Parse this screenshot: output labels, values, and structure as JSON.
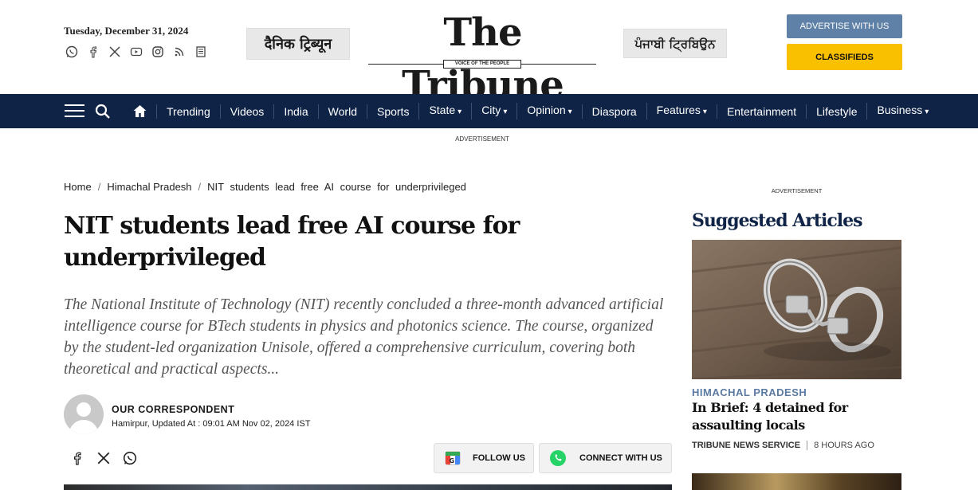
{
  "header": {
    "date": "Tuesday, December 31, 2024",
    "socials": [
      "whatsapp-icon",
      "facebook-icon",
      "x-icon",
      "youtube-icon",
      "instagram-icon",
      "rss-icon",
      "epaper-icon"
    ],
    "dainik_label": "दैनिक ट्रिब्यून",
    "logo_text": "The Tribune",
    "logo_tagline": "VOICE OF THE PEOPLE",
    "punjabi_label": "ਪੰਜਾਬੀ ਟ੍ਰਿਬਿਉਨ",
    "advertise_label": "ADVERTISE WITH US",
    "classifieds_label": "CLASSIFIEDS",
    "colors": {
      "nav_bg": "#0f2346",
      "advertise_bg": "#5f80a7",
      "classifieds_bg": "#f9c000"
    }
  },
  "nav": {
    "items": [
      {
        "label": "Trending",
        "dropdown": false
      },
      {
        "label": "Videos",
        "dropdown": false
      },
      {
        "label": "India",
        "dropdown": false
      },
      {
        "label": "World",
        "dropdown": false
      },
      {
        "label": "Sports",
        "dropdown": false
      },
      {
        "label": "State",
        "dropdown": true
      },
      {
        "label": "City",
        "dropdown": true
      },
      {
        "label": "Opinion",
        "dropdown": true
      },
      {
        "label": "Diaspora",
        "dropdown": false
      },
      {
        "label": "Features",
        "dropdown": true
      },
      {
        "label": "Entertainment",
        "dropdown": false
      },
      {
        "label": "Lifestyle",
        "dropdown": false
      },
      {
        "label": "Business",
        "dropdown": true
      }
    ],
    "caret": "▾"
  },
  "ad_label": "ADVERTISEMENT",
  "breadcrumb": {
    "home": "Home",
    "section": "Himachal Pradesh",
    "current": "NIT students lead free AI course for underprivileged",
    "sep": "/"
  },
  "article": {
    "title": "NIT students lead free AI course for underprivileged",
    "summary": "The National Institute of Technology (NIT) recently concluded a three-month advanced artificial intelligence course for BTech students in physics and photonics science. The course, organized by the student-led organization Unisole, offered a comprehensive curriculum, covering both theoretical and practical aspects...",
    "author": "OUR CORRESPONDENT",
    "meta": "Hamirpur, Updated At : 09:01 AM Nov 02, 2024 IST",
    "follow_label": "FOLLOW US",
    "connect_label": "CONNECT WITH US"
  },
  "sidebar": {
    "ad_label": "ADVERTISEMENT",
    "title": "Suggested Articles",
    "article": {
      "category": "HIMACHAL PRADESH",
      "headline": "In Brief: 4 detained for assaulting locals",
      "source": "TRIBUNE NEWS SERVICE",
      "time": "8 HOURS AGO"
    }
  }
}
